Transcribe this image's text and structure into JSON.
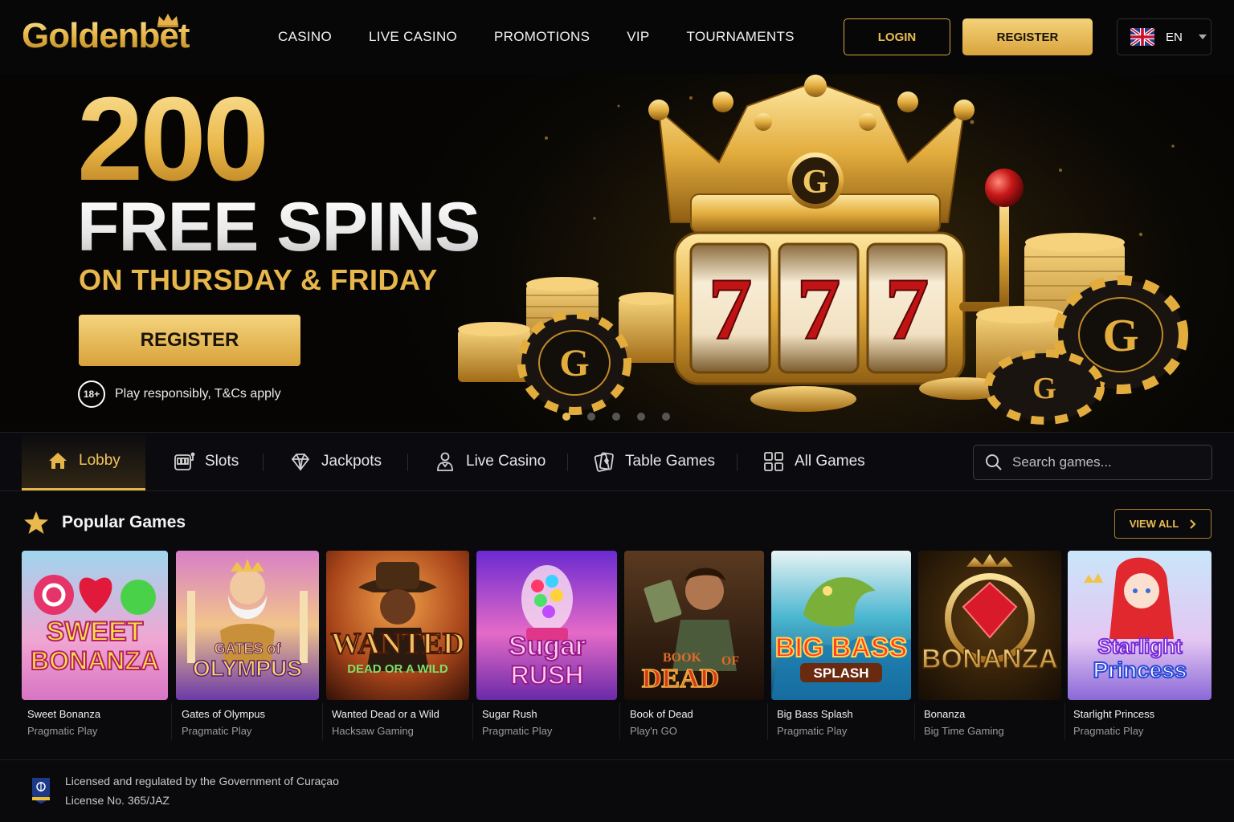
{
  "brand": {
    "logo_text": "Goldenbet"
  },
  "nav": {
    "items": [
      "CASINO",
      "LIVE CASINO",
      "PROMOTIONS",
      "VIP",
      "TOURNAMENTS"
    ]
  },
  "header": {
    "login_label": "LOGIN",
    "register_label": "REGISTER",
    "language": "EN",
    "flag_icon": "uk-flag-icon"
  },
  "hero": {
    "amount": "200",
    "title": "FREE SPINS",
    "subtitle": "ON THURSDAY & FRIDAY",
    "cta_label": "REGISTER",
    "age_badge": "18+",
    "note": "Play responsibly, T&Cs apply",
    "slide_count": 5,
    "active_slide": 1
  },
  "categories": [
    {
      "label": "Lobby",
      "icon": "home-icon",
      "active": true
    },
    {
      "label": "Slots",
      "icon": "slot-machine-icon",
      "active": false
    },
    {
      "label": "Jackpots",
      "icon": "diamond-icon",
      "active": false
    },
    {
      "label": "Live Casino",
      "icon": "dealer-icon",
      "active": false
    },
    {
      "label": "Table Games",
      "icon": "cards-icon",
      "active": false
    },
    {
      "label": "All Games",
      "icon": "grid-icon",
      "active": false
    }
  ],
  "search": {
    "placeholder": "Search games..."
  },
  "popular": {
    "title": "Popular Games",
    "view_all_label": "VIEW ALL",
    "games": [
      {
        "name": "Sweet Bonanza",
        "provider": "Pragmatic Play",
        "art_text": "SWEET BONANZA",
        "accent": "#e4426a"
      },
      {
        "name": "Gates of Olympus",
        "provider": "Pragmatic Play",
        "art_text": "GATES of OLYMPUS",
        "accent": "#8b54c9"
      },
      {
        "name": "Wanted Dead or a Wild",
        "provider": "Hacksaw Gaming",
        "art_text": "WANTED DEAD OR A WILD",
        "accent": "#c86a1c"
      },
      {
        "name": "Sugar Rush",
        "provider": "Pragmatic Play",
        "art_text": "Sugar RUSH",
        "accent": "#c54bd8"
      },
      {
        "name": "Book of Dead",
        "provider": "Play'n GO",
        "art_text": "BOOK OF DEAD",
        "accent": "#6a3a18"
      },
      {
        "name": "Big Bass Splash",
        "provider": "Pragmatic Play",
        "art_text": "BIG BASS SPLASH",
        "accent": "#1f8bb0"
      },
      {
        "name": "Bonanza",
        "provider": "Big Time Gaming",
        "art_text": "BONANZA",
        "accent": "#8a5a12"
      },
      {
        "name": "Starlight Princess",
        "provider": "Pragmatic Play",
        "art_text": "Starlight Princess",
        "accent": "#5a6fe0"
      }
    ]
  },
  "footer": {
    "license_line1": "Licensed and regulated by the Government of Curaçao",
    "license_line2": "License No. 365/JAZ"
  },
  "colors": {
    "gold": "#e9bd52",
    "background": "#0a0a0d"
  }
}
